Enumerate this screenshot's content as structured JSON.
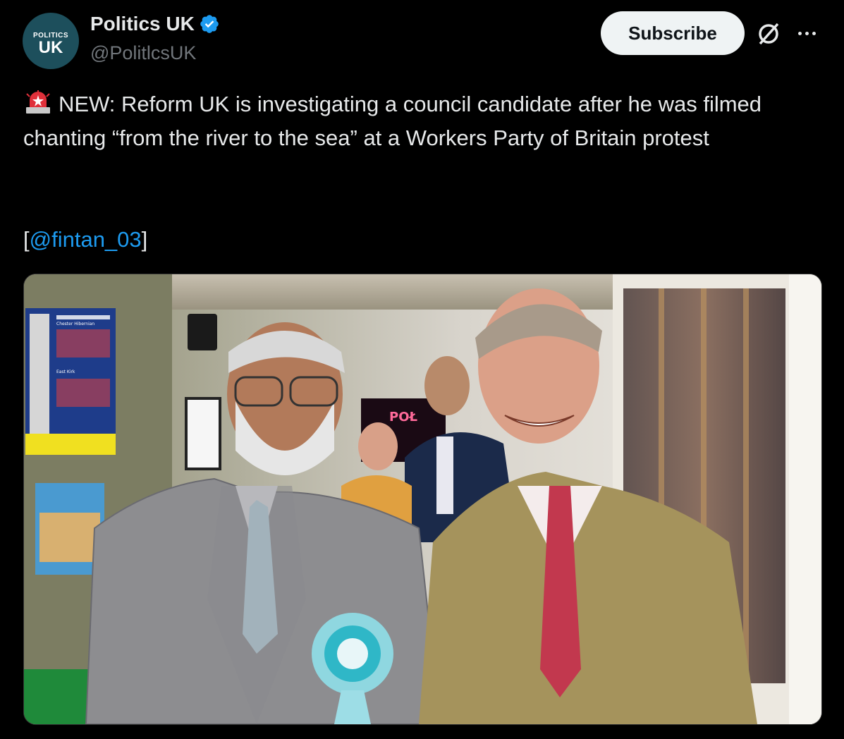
{
  "account": {
    "name": "Politics UK",
    "handle": "@PolitlcsUK",
    "avatar_top": "POLITICS",
    "avatar_main": "UK"
  },
  "actions": {
    "subscribe_label": "Subscribe",
    "grok_icon": "grok-slash-icon",
    "more_icon": "more-horizontal-icon"
  },
  "tweet": {
    "siren_icon": "police-siren-emoji",
    "text": "NEW: Reform UK is investigating a council candidate after he was filmed chanting “from the river to the sea” at a Workers Party of Britain protest",
    "mention_prefix": "[",
    "mention": "@fintan_03",
    "mention_suffix": "]"
  },
  "media": {
    "tv_list_title_1": "Chester Hibernian",
    "tv_list_title_2": "East Kirk",
    "sign_text": "POŁ"
  },
  "colors": {
    "background": "#000000",
    "text": "#e7e9ea",
    "secondary": "#71767b",
    "link": "#1d9bf0",
    "verified": "#1d9bf0",
    "avatar": "#1d4f5c"
  }
}
